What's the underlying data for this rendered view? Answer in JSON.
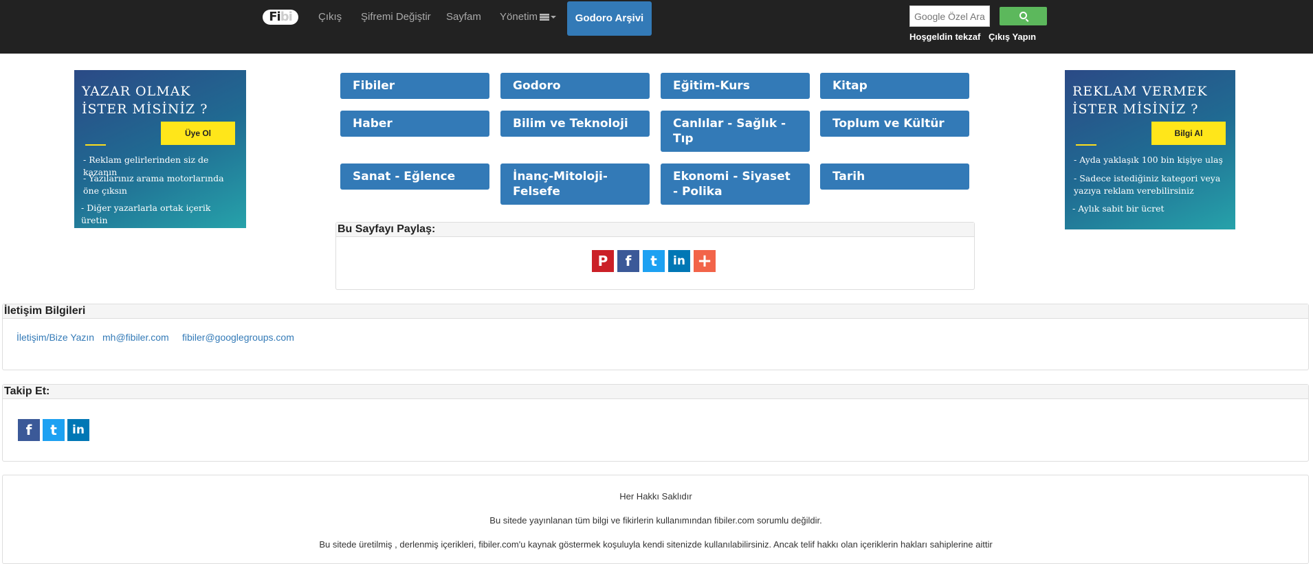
{
  "nav": {
    "logo_a": "Fi",
    "logo_b": "bi",
    "links": [
      "Çıkış",
      "Şifremi Değiştir",
      "Sayfam",
      "Yönetim"
    ],
    "archive": "Godoro Arşivi",
    "search_placeholder": "Google Özel Arama",
    "welcome": "Hoşgeldin tekzaf",
    "logout": "Çıkış Yapın"
  },
  "ad_left": {
    "title": "YAZAR OLMAK\nİSTER MİSİNİZ ?",
    "button": "Üye Ol",
    "bullets": [
      "- Reklam gelirlerinden siz de kazanın",
      "- Yazılarınız arama motorlarında öne çıksın",
      "- Diğer yazarlarla ortak içerik üretin"
    ]
  },
  "ad_right": {
    "title": "REKLAM VERMEK\nİSTER MİSİNİZ ?",
    "button": "Bilgi Al",
    "bullets": [
      "- Ayda yaklaşık 100 bin kişiye ulaş",
      "- Sadece istediğiniz kategori veya yazıya reklam verebilirsiniz",
      "- Aylık sabit bir ücret"
    ]
  },
  "categories": [
    "Fibiler",
    "Godoro",
    "Eğitim-Kurs",
    "Kitap",
    "Haber",
    "Bilim ve Teknoloji",
    "Canlılar - Sağlık - Tıp",
    "Toplum ve Kültür",
    "Sanat - Eğlence",
    "İnanç-Mitoloji-Felsefe",
    "Ekonomi - Siyaset - Polika",
    "Tarih"
  ],
  "share": {
    "title": "Bu Sayfayı Paylaş:",
    "icons": [
      "pinterest-icon",
      "facebook-icon",
      "twitter-icon",
      "linkedin-icon",
      "plus-icon"
    ]
  },
  "contact": {
    "title": "İletişim Bilgileri",
    "links": [
      "İletişim/Bize Yazın",
      "mh@fibiler.com",
      "fibiler@googlegroups.com"
    ]
  },
  "follow": {
    "title": "Takip Et:",
    "icons": [
      "facebook-icon",
      "twitter-icon",
      "linkedin-icon"
    ]
  },
  "footer": {
    "lines": [
      "Her Hakkı Saklıdır",
      "Bu sitede yayınlanan tüm bilgi ve fikirlerin kullanımından fibiler.com sorumlu değildir.",
      "Bu sitede üretilmiş , derlenmiş içerikleri, fibiler.com'u kaynak göstermek koşuluyla kendi sitenizde kullanılabilirsiniz. Ancak telif hakkı olan içeriklerin hakları sahiplerine aittir"
    ]
  },
  "colors": {
    "nav_bg": "#222222",
    "primary": "#337ab7",
    "search_btn": "#5cb85c",
    "ad_button": "#ffe61a"
  }
}
